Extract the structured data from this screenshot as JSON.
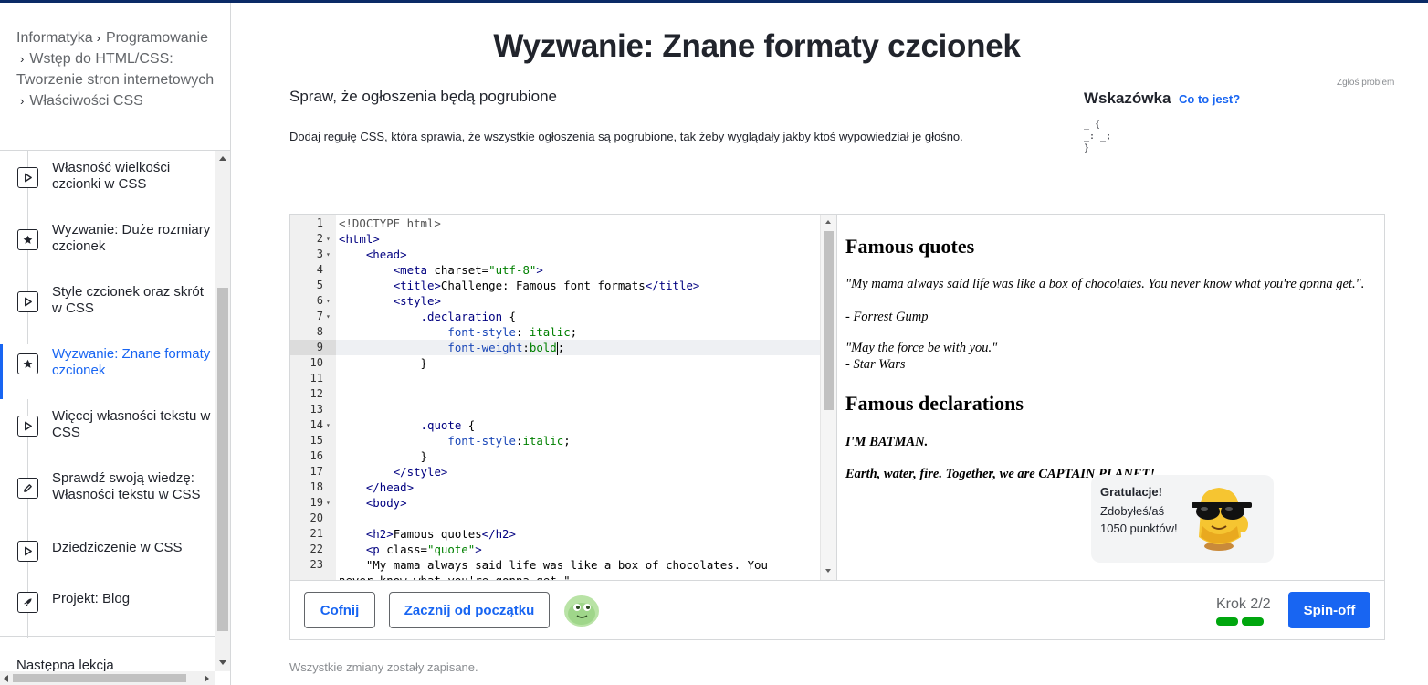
{
  "colors": {
    "accent": "#1865f2",
    "text": "#21242c",
    "muted": "#626569",
    "progress": "#00a60e",
    "topbar": "#0a2a66"
  },
  "breadcrumb": [
    "Informatyka",
    "Programowanie",
    "Wstęp do HTML/CSS: Tworzenie stron internetowych",
    "Właściwości CSS"
  ],
  "lessons": [
    {
      "label": "Własność wielkości czcionki w CSS",
      "icon": "play-icon",
      "active": false
    },
    {
      "label": "Wyzwanie: Duże rozmiary czcionek",
      "icon": "star-icon",
      "active": false
    },
    {
      "label": "Style czcionek oraz skrót w CSS",
      "icon": "play-icon",
      "active": false
    },
    {
      "label": "Wyzwanie: Znane formaty czcionek",
      "icon": "star-icon",
      "active": true
    },
    {
      "label": "Więcej własności tekstu w CSS",
      "icon": "play-icon",
      "active": false
    },
    {
      "label": "Sprawdź swoją wiedzę: Własności tekstu w CSS",
      "icon": "pencil-icon",
      "active": false
    },
    {
      "label": "Dziedziczenie w CSS",
      "icon": "play-icon",
      "active": false
    },
    {
      "label": "Projekt: Blog",
      "icon": "rocket-icon",
      "active": false
    }
  ],
  "next_lesson": "Następna lekcja",
  "page_title": "Wyzwanie: Znane formaty czcionek",
  "report_link": "Zgłoś problem",
  "task": {
    "title": "Spraw, że ogłoszenia będą pogrubione",
    "description": "Dodaj regułę CSS, która sprawia, że wszystkie ogłoszenia są pogrubione, tak żeby wyglądały jakby ktoś wypowiedział je głośno."
  },
  "hint": {
    "title": "Wskazówka",
    "link": "Co to jest?",
    "code": "_ {\n_: _;\n}"
  },
  "editor": {
    "current_line": 9,
    "lines": [
      {
        "n": "1",
        "fold": false,
        "segs": [
          [
            "t-doctype",
            "<!DOCTYPE html>"
          ]
        ]
      },
      {
        "n": "2",
        "fold": true,
        "segs": [
          [
            "t-tag",
            "<html>"
          ]
        ]
      },
      {
        "n": "3",
        "fold": true,
        "segs": [
          [
            "t-plain",
            "    "
          ],
          [
            "t-tag",
            "<head>"
          ]
        ]
      },
      {
        "n": "4",
        "fold": false,
        "segs": [
          [
            "t-plain",
            "        "
          ],
          [
            "t-tag",
            "<meta "
          ],
          [
            "t-attr",
            "charset="
          ],
          [
            "t-str",
            "\"utf-8\""
          ],
          [
            "t-tag",
            ">"
          ]
        ]
      },
      {
        "n": "5",
        "fold": false,
        "segs": [
          [
            "t-plain",
            "        "
          ],
          [
            "t-tag",
            "<title>"
          ],
          [
            "t-plain",
            "Challenge: Famous font formats"
          ],
          [
            "t-tag",
            "</title>"
          ]
        ]
      },
      {
        "n": "6",
        "fold": true,
        "segs": [
          [
            "t-plain",
            "        "
          ],
          [
            "t-tag",
            "<style>"
          ]
        ]
      },
      {
        "n": "7",
        "fold": true,
        "segs": [
          [
            "t-plain",
            "            "
          ],
          [
            "t-sel",
            ".declaration"
          ],
          [
            "t-plain",
            " {"
          ]
        ]
      },
      {
        "n": "8",
        "fold": false,
        "segs": [
          [
            "t-plain",
            "                "
          ],
          [
            "t-prop",
            "font-style"
          ],
          [
            "t-plain",
            ": "
          ],
          [
            "t-str",
            "italic"
          ],
          [
            "t-plain",
            ";"
          ]
        ]
      },
      {
        "n": "9",
        "fold": false,
        "segs": [
          [
            "t-plain",
            "                "
          ],
          [
            "t-prop",
            "font-weight"
          ],
          [
            "t-plain",
            ":"
          ],
          [
            "t-str",
            "bold"
          ],
          [
            "cursor",
            ""
          ],
          [
            "t-plain",
            ";"
          ]
        ]
      },
      {
        "n": "10",
        "fold": false,
        "segs": [
          [
            "t-plain",
            "            }"
          ]
        ]
      },
      {
        "n": "11",
        "fold": false,
        "segs": [
          [
            "t-plain",
            ""
          ]
        ]
      },
      {
        "n": "12",
        "fold": false,
        "segs": [
          [
            "t-plain",
            ""
          ]
        ]
      },
      {
        "n": "13",
        "fold": false,
        "segs": [
          [
            "t-plain",
            ""
          ]
        ]
      },
      {
        "n": "14",
        "fold": true,
        "segs": [
          [
            "t-plain",
            "            "
          ],
          [
            "t-sel",
            ".quote"
          ],
          [
            "t-plain",
            " {"
          ]
        ]
      },
      {
        "n": "15",
        "fold": false,
        "segs": [
          [
            "t-plain",
            "                "
          ],
          [
            "t-prop",
            "font-style"
          ],
          [
            "t-plain",
            ":"
          ],
          [
            "t-str",
            "italic"
          ],
          [
            "t-plain",
            ";"
          ]
        ]
      },
      {
        "n": "16",
        "fold": false,
        "segs": [
          [
            "t-plain",
            "            }"
          ]
        ]
      },
      {
        "n": "17",
        "fold": false,
        "segs": [
          [
            "t-plain",
            "        "
          ],
          [
            "t-tag",
            "</style>"
          ]
        ]
      },
      {
        "n": "18",
        "fold": false,
        "segs": [
          [
            "t-plain",
            "    "
          ],
          [
            "t-tag",
            "</head>"
          ]
        ]
      },
      {
        "n": "19",
        "fold": true,
        "segs": [
          [
            "t-plain",
            "    "
          ],
          [
            "t-tag",
            "<body>"
          ]
        ]
      },
      {
        "n": "20",
        "fold": false,
        "segs": [
          [
            "t-plain",
            ""
          ]
        ]
      },
      {
        "n": "21",
        "fold": false,
        "segs": [
          [
            "t-plain",
            "    "
          ],
          [
            "t-tag",
            "<h2>"
          ],
          [
            "t-plain",
            "Famous quotes"
          ],
          [
            "t-tag",
            "</h2>"
          ]
        ]
      },
      {
        "n": "22",
        "fold": false,
        "segs": [
          [
            "t-plain",
            "    "
          ],
          [
            "t-tag",
            "<p "
          ],
          [
            "t-attr",
            "class="
          ],
          [
            "t-str",
            "\"quote\""
          ],
          [
            "t-tag",
            ">"
          ]
        ]
      },
      {
        "n": "23",
        "fold": false,
        "segs": [
          [
            "t-plain",
            "    \"My mama always said life was like a box of chocolates. You"
          ]
        ]
      },
      {
        "n": "",
        "fold": false,
        "segs": [
          [
            "t-plain",
            "never know what you're gonna get.\""
          ]
        ]
      }
    ]
  },
  "preview": {
    "h2_quotes": "Famous quotes",
    "quote1": "\"My mama always said life was like a box of chocolates. You never know what you're gonna get.\".",
    "quote1_author": "- Forrest Gump",
    "quote2": "\"May the force be with you.\"",
    "quote2_author": "- Star Wars",
    "h2_declarations": "Famous declarations",
    "decl1": "I'M BATMAN.",
    "decl2": "Earth, water, fire. Together, we are CAPTAIN PLANET!"
  },
  "toast": {
    "title": "Gratulacje!",
    "body": "Zdobyłeś/aś 1050 punktów!"
  },
  "footer": {
    "back_label": "Cofnij",
    "restart_label": "Zacznij od początku",
    "step_label": "Krok 2/2",
    "steps_completed": 2,
    "steps_total": 2,
    "spinoff_label": "Spin-off"
  },
  "saved_status": "Wszystkie zmiany zostały zapisane."
}
